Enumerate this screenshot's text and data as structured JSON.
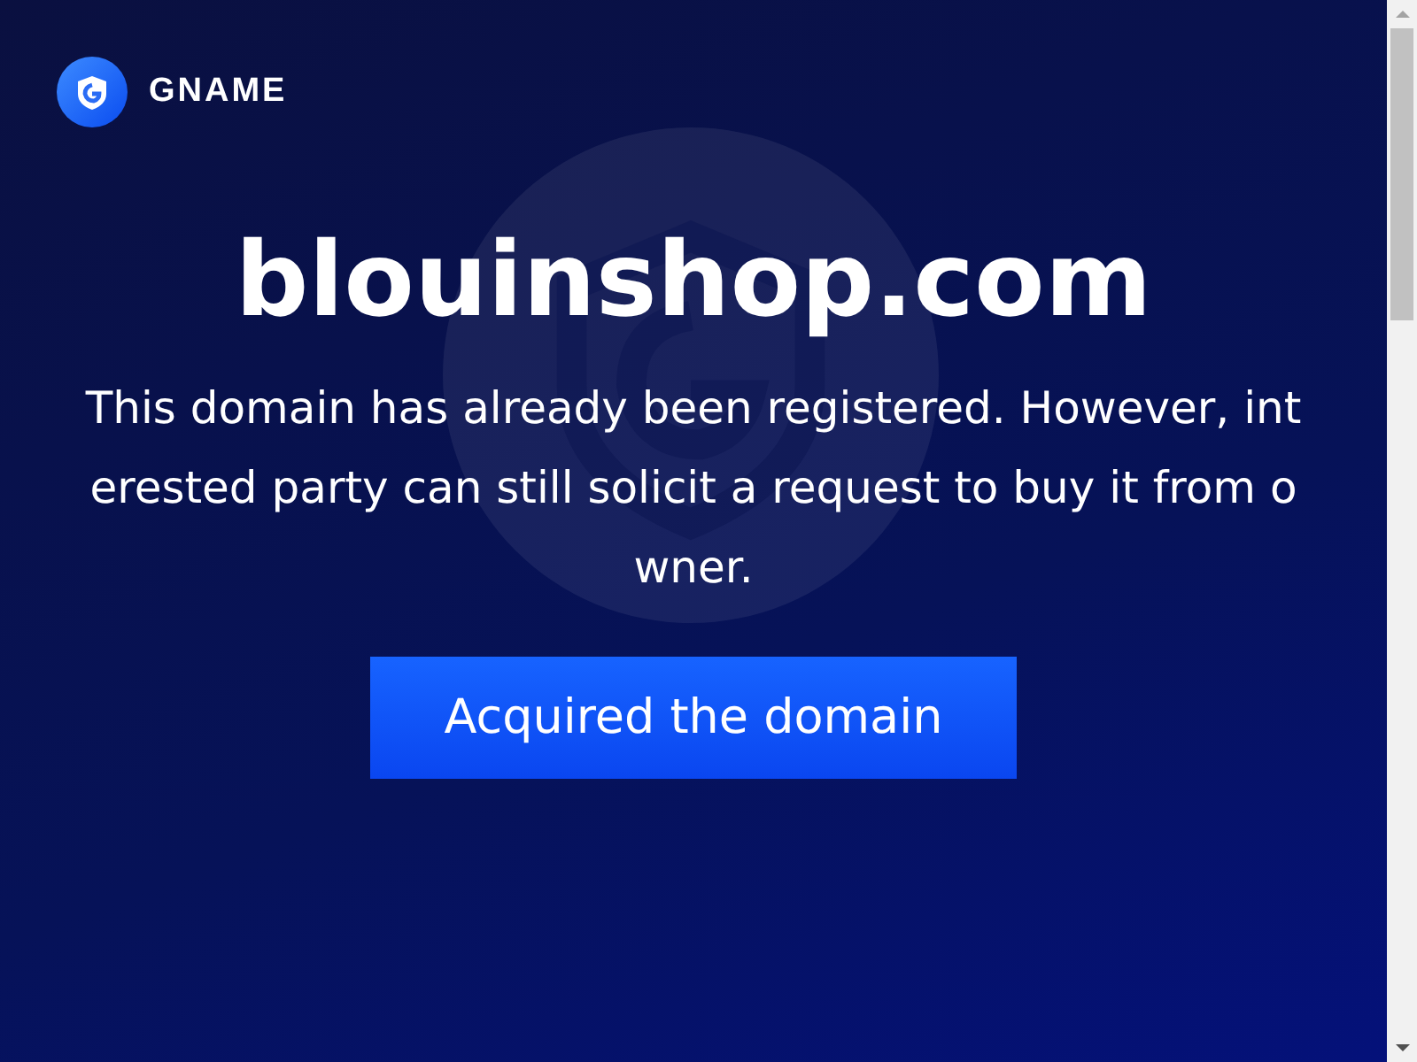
{
  "header": {
    "brand": "GNAME"
  },
  "domain": "blouinshop.com",
  "message": "This domain has already been registered. However, interested party can still solicit a request to buy it from owner.",
  "button": "Acquired the domain"
}
